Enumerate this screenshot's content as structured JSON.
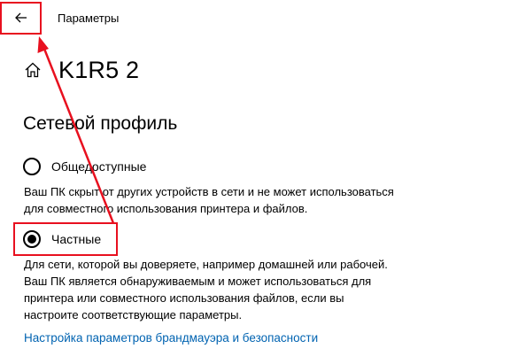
{
  "window": {
    "title": "Параметры"
  },
  "header": {
    "page_title": "K1R5 2"
  },
  "network_profile": {
    "section_title": "Сетевой профиль",
    "options": [
      {
        "label": "Общедоступные",
        "checked": false,
        "description": [
          "Ваш ПК скрыт от других устройств в сети и не может использоваться",
          "для совместного использования принтера и файлов."
        ]
      },
      {
        "label": "Частные",
        "checked": true,
        "description": [
          "Для сети, которой вы доверяете, например домашней или рабочей.",
          "Ваш ПК является обнаруживаемым и может использоваться для",
          "принтера или совместного использования файлов, если вы",
          "настроите соответствующие параметры."
        ]
      }
    ]
  },
  "links": {
    "firewall": "Настройка параметров брандмауэра и безопасности"
  },
  "icons": {
    "back": "back-arrow-icon",
    "home": "home-icon"
  },
  "colors": {
    "annotation": "#e8101f",
    "link": "#0063b1"
  }
}
